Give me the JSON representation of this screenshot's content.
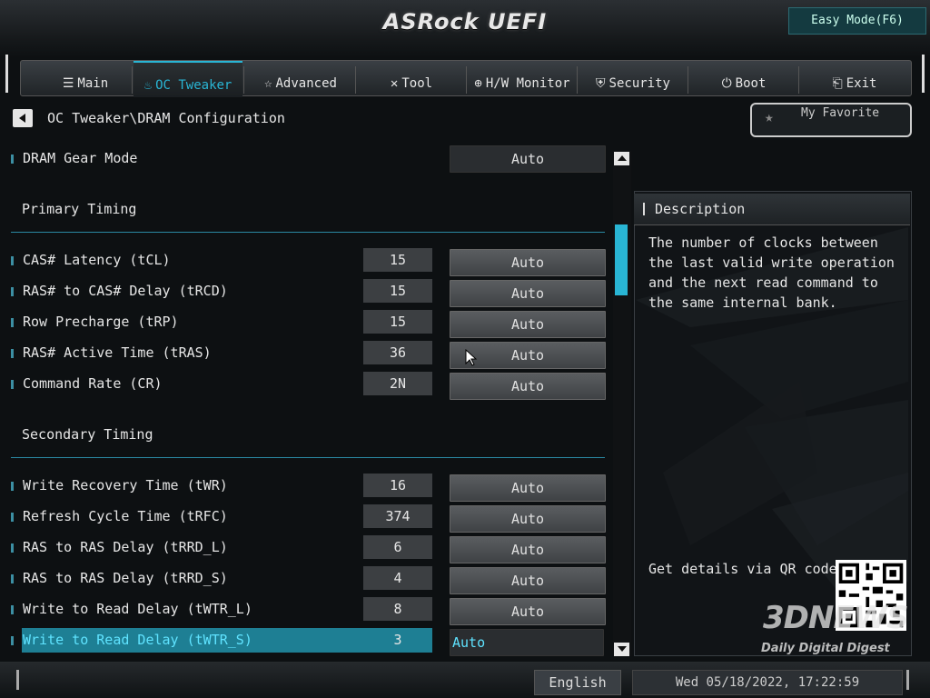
{
  "header": {
    "logo": "ASRock UEFI",
    "easy_mode_label": "Easy Mode(F6)"
  },
  "tabs": [
    {
      "label": "Main",
      "icon": "list-icon",
      "active": false
    },
    {
      "label": "OC Tweaker",
      "icon": "flame-icon",
      "active": true
    },
    {
      "label": "Advanced",
      "icon": "star-icon",
      "active": false
    },
    {
      "label": "Tool",
      "icon": "tools-icon",
      "active": false
    },
    {
      "label": "H/W Monitor",
      "icon": "monitor-icon",
      "active": false
    },
    {
      "label": "Security",
      "icon": "shield-icon",
      "active": false
    },
    {
      "label": "Boot",
      "icon": "power-icon",
      "active": false
    },
    {
      "label": "Exit",
      "icon": "exit-icon",
      "active": false
    }
  ],
  "breadcrumb": "OC Tweaker\\DRAM Configuration",
  "favorite_label": "My Favorite",
  "settings": {
    "dram_gear_mode": {
      "label": "DRAM Gear Mode",
      "option": "Auto"
    },
    "primary_timing": "Primary Timing",
    "primary": [
      {
        "label": "CAS# Latency (tCL)",
        "value": "15",
        "option": "Auto"
      },
      {
        "label": "RAS# to CAS# Delay (tRCD)",
        "value": "15",
        "option": "Auto"
      },
      {
        "label": "Row Precharge (tRP)",
        "value": "15",
        "option": "Auto"
      },
      {
        "label": "RAS# Active Time (tRAS)",
        "value": "36",
        "option": "Auto"
      },
      {
        "label": "Command Rate (CR)",
        "value": "2N",
        "option": "Auto"
      }
    ],
    "secondary_timing": "Secondary Timing",
    "secondary": [
      {
        "label": "Write Recovery Time (tWR)",
        "value": "16",
        "option": "Auto"
      },
      {
        "label": "Refresh Cycle Time (tRFC)",
        "value": "374",
        "option": "Auto"
      },
      {
        "label": "RAS to RAS Delay (tRRD_L)",
        "value": "6",
        "option": "Auto"
      },
      {
        "label": "RAS to RAS Delay (tRRD_S)",
        "value": "4",
        "option": "Auto"
      },
      {
        "label": "Write to Read Delay (tWTR_L)",
        "value": "8",
        "option": "Auto"
      },
      {
        "label": "Write to Read Delay (tWTR_S)",
        "value": "3",
        "option": "Auto"
      }
    ]
  },
  "description": {
    "title": "Description",
    "text": "The number of clocks between the last valid write operation and the next read command to the same internal bank.",
    "qr_label": "Get details via QR code"
  },
  "watermark": {
    "line1": "3DNEWS",
    "line2": "Daily Digital Digest"
  },
  "footer": {
    "language": "English",
    "datetime": "Wed 05/18/2022, 17:22:59"
  },
  "colors": {
    "accent": "#29b5d4",
    "highlight_row": "#1e7f94",
    "background": "#0d1012"
  }
}
